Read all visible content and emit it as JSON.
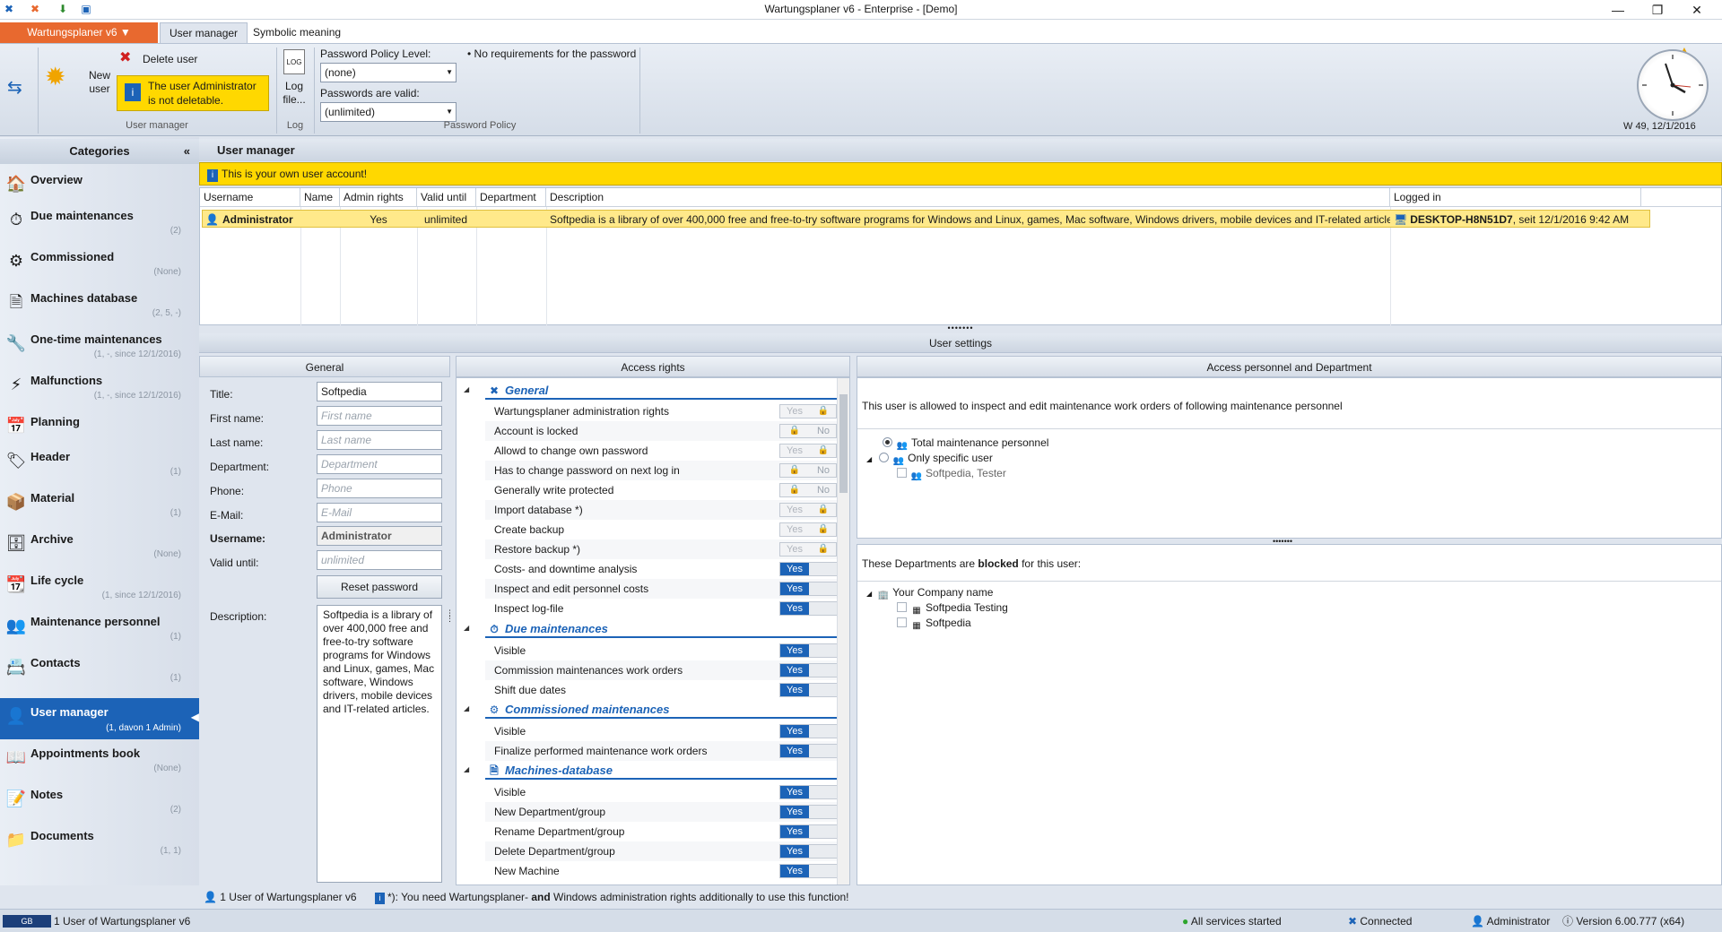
{
  "window": {
    "title": "Wartungsplaner v6 - Enterprise - [Demo]",
    "controls": {
      "minimize": "—",
      "maximize": "❐",
      "close": "✕"
    }
  },
  "ribbon": {
    "app_menu": "Wartungsplaner v6 ▼",
    "tabs": [
      "User manager",
      "Symbolic meaning"
    ],
    "new_user_label": "New user",
    "delete_user_label": "Delete user",
    "tooltip": "The user Administrator is not deletable.",
    "log_file_label": "Log file...",
    "group_user_manager": "User manager",
    "group_log": "Log",
    "group_password_policy": "Password Policy",
    "pwd_level_label": "Password Policy Level:",
    "pwd_level_value": "(none)",
    "pwd_valid_label": "Passwords are valid:",
    "pwd_valid_value": "(unlimited)",
    "pwd_note": "• No requirements for the password",
    "date_label": "W 49, 12/1/2016"
  },
  "sidebar": {
    "title": "Categories",
    "collapse": "«",
    "items": [
      {
        "label": "Overview",
        "count": "",
        "icon": "🏠"
      },
      {
        "label": "Due maintenances",
        "count": "(2)",
        "icon": "⏱"
      },
      {
        "label": "Commissioned",
        "count": "(None)",
        "icon": "⚙"
      },
      {
        "label": "Machines database",
        "count": "(2, 5, -)",
        "icon": "🗎"
      },
      {
        "label": "One-time maintenances",
        "count": "(1, -, since 12/1/2016)",
        "icon": "🔧"
      },
      {
        "label": "Malfunctions",
        "count": "(1, -, since 12/1/2016)",
        "icon": "⚡"
      },
      {
        "label": "Planning",
        "count": "",
        "icon": "📅"
      },
      {
        "label": "Header",
        "count": "(1)",
        "icon": "🏷"
      },
      {
        "label": "Material",
        "count": "(1)",
        "icon": "📦"
      },
      {
        "label": "Archive",
        "count": "(None)",
        "icon": "🗄"
      },
      {
        "label": "Life cycle",
        "count": "(1, since 12/1/2016)",
        "icon": "📆"
      },
      {
        "label": "Maintenance  personnel",
        "count": "(1)",
        "icon": "👥"
      },
      {
        "label": "Contacts",
        "count": "(1)",
        "icon": "📇"
      },
      {
        "label": "User manager",
        "count": "(1, davon 1 Admin)",
        "icon": "👤"
      },
      {
        "label": "Appointments  book",
        "count": "(None)",
        "icon": "📖"
      },
      {
        "label": "Notes",
        "count": "(2)",
        "icon": "📝"
      },
      {
        "label": "Documents",
        "count": "(1, 1)",
        "icon": "📁"
      }
    ]
  },
  "main": {
    "title": "User manager",
    "own_account_banner": "This is your own user account!",
    "table": {
      "headers": [
        "Username",
        "Name",
        "Admin rights",
        "Valid until",
        "Department",
        "Description",
        "Logged in"
      ],
      "row": {
        "username": "Administrator",
        "name": "",
        "admin": "Yes",
        "valid": "unlimited",
        "department": "",
        "description": "Softpedia is a library of over 400,000 free and free-to-try software programs for Windows and Linux, games, Mac software, Windows drivers, mobile devices and IT-related articles.",
        "logged_host": "DESKTOP-H8N51D7",
        "logged_since": ", seit 12/1/2016 9:42 AM"
      }
    },
    "user_settings_title": "User settings"
  },
  "general": {
    "header": "General",
    "title_label": "Title:",
    "title_value": "Softpedia",
    "first_label": "First name:",
    "first_ph": "First name",
    "last_label": "Last name:",
    "last_ph": "Last name",
    "dept_label": "Department:",
    "dept_ph": "Department",
    "phone_label": "Phone:",
    "phone_ph": "Phone",
    "email_label": "E-Mail:",
    "email_ph": "E-Mail",
    "username_label": "Username:",
    "username_value": "Administrator",
    "valid_label": "Valid until:",
    "valid_ph": "unlimited",
    "reset_button": "Reset password",
    "desc_label": "Description:",
    "desc_value": "Softpedia is a library of over 400,000 free and free-to-try software programs for Windows and Linux, games, Mac software, Windows drivers, mobile devices and IT-related articles."
  },
  "access": {
    "header": "Access rights",
    "yes": "Yes",
    "no": "No",
    "lock": "🔒",
    "sections": [
      {
        "title": "General",
        "icon": "✖",
        "rows": [
          {
            "label": "Wartungsplaner administration rights",
            "state": "lockyes"
          },
          {
            "label": "Account is locked",
            "state": "lockno"
          },
          {
            "label": "Allowd to change own password",
            "state": "lockyes"
          },
          {
            "label": "Has to change password on next log in",
            "state": "lockno"
          },
          {
            "label": "Generally write protected",
            "state": "lockno"
          },
          {
            "label": "Import database *)",
            "state": "lockyes"
          },
          {
            "label": "Create backup",
            "state": "lockyes"
          },
          {
            "label": "Restore backup *)",
            "state": "lockyes"
          },
          {
            "label": "Costs- and downtime analysis",
            "state": "yes"
          },
          {
            "label": "Inspect and edit personnel costs",
            "state": "yes"
          },
          {
            "label": "Inspect log-file",
            "state": "yes"
          }
        ]
      },
      {
        "title": "Due maintenances",
        "icon": "⏱",
        "rows": [
          {
            "label": "Visible",
            "state": "yes"
          },
          {
            "label": "Commission maintenances work orders",
            "state": "yes"
          },
          {
            "label": "Shift due dates",
            "state": "yes"
          }
        ]
      },
      {
        "title": "Commissioned maintenances",
        "icon": "⚙",
        "rows": [
          {
            "label": "Visible",
            "state": "yes"
          },
          {
            "label": "Finalize performed maintenance work orders",
            "state": "yes"
          }
        ]
      },
      {
        "title": "Machines-database",
        "icon": "🗎",
        "rows": [
          {
            "label": "Visible",
            "state": "yes"
          },
          {
            "label": "New Department/group",
            "state": "yes"
          },
          {
            "label": "Rename Department/group",
            "state": "yes"
          },
          {
            "label": "Delete Department/group",
            "state": "yes"
          },
          {
            "label": "New Machine",
            "state": "yes"
          }
        ]
      }
    ]
  },
  "personnel": {
    "header": "Access personnel and Department",
    "intro": "This user is allowed to inspect and edit maintenance work orders of following maintenance personnel",
    "total": "Total maintenance personnel",
    "specific": "Only specific user",
    "member": "Softpedia, Tester",
    "blocked_pre": "These Departments  are ",
    "blocked_word": "blocked",
    "blocked_post": " for this user:",
    "company": "Your Company name",
    "dept1": "Softpedia Testing",
    "dept2": "Softpedia"
  },
  "status": {
    "users": "1 User of Wartungsplaner v6",
    "note_pre": "*): You need Wartungsplaner- ",
    "note_and": "and",
    "note_post": " Windows administration rights additionally to use this function!",
    "bottom_left": "1 User of Wartungsplaner v6",
    "services": "All services started",
    "connected": "Connected",
    "user": "Administrator",
    "version": "Version 6.00.777 (x64)"
  }
}
